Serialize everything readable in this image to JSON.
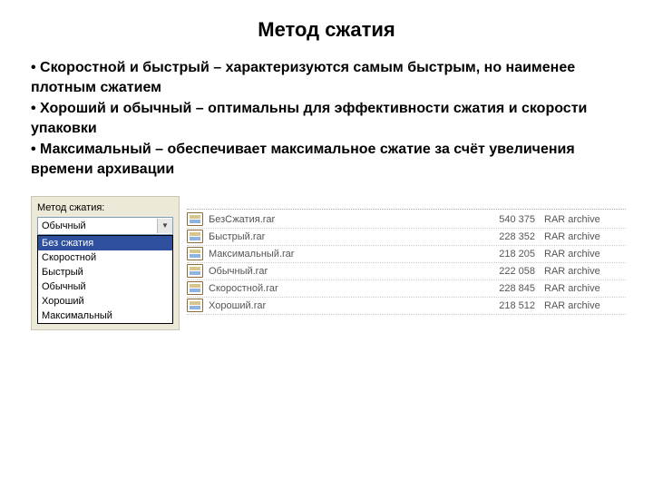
{
  "title": "Метод сжатия",
  "bullets": [
    "Скоростной и быстрый – характеризуются самым быстрым, но наименее плотным сжатием",
    "Хороший и обычный – оптимальны для эффективности сжатия и скорости упаковки",
    "Максимальный – обеспечивает максимальное сжатие за счёт увеличения времени архивации"
  ],
  "dropdown": {
    "label": "Метод сжатия:",
    "selected": "Обычный",
    "options": [
      "Без сжатия",
      "Скоростной",
      "Быстрый",
      "Обычный",
      "Хороший",
      "Максимальный"
    ],
    "highlighted_index": 0
  },
  "files": [
    {
      "name": "БезСжатия.rar",
      "size": "540 375",
      "type": "RAR archive"
    },
    {
      "name": "Быстрый.rar",
      "size": "228 352",
      "type": "RAR archive"
    },
    {
      "name": "Максимальный.rar",
      "size": "218 205",
      "type": "RAR archive"
    },
    {
      "name": "Обычный.rar",
      "size": "222 058",
      "type": "RAR archive"
    },
    {
      "name": "Скоростной.rar",
      "size": "228 845",
      "type": "RAR archive"
    },
    {
      "name": "Хороший.rar",
      "size": "218 512",
      "type": "RAR archive"
    }
  ]
}
